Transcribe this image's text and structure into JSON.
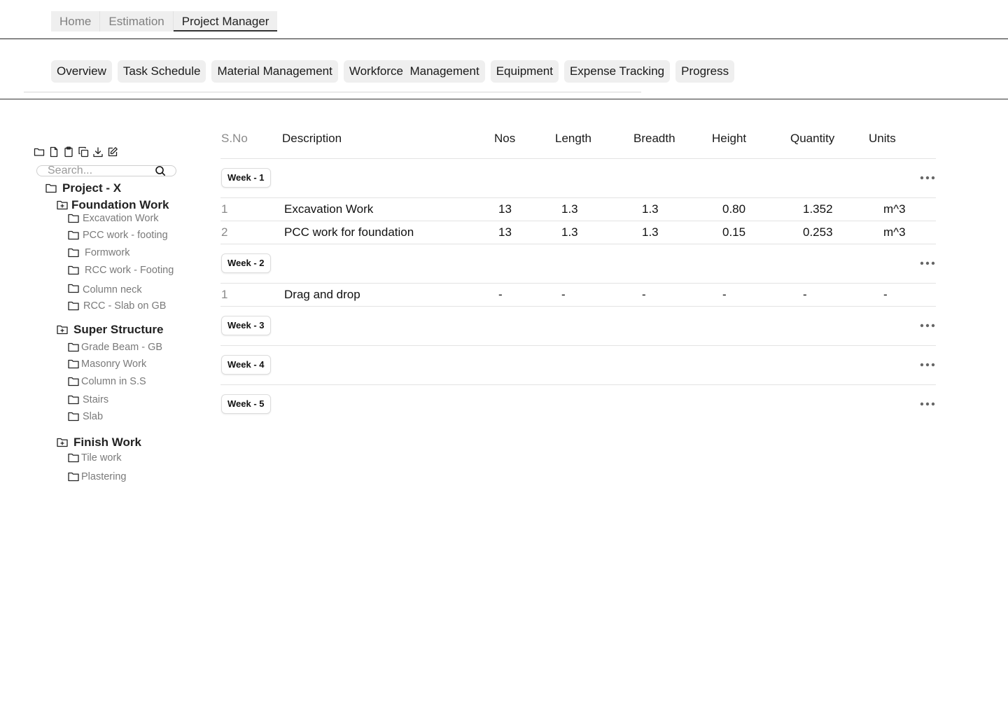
{
  "top_nav": {
    "tabs": [
      "Home",
      "Estimation",
      "Project Manager"
    ],
    "active": "Project Manager"
  },
  "sub_tabs": [
    "Overview",
    "Task Schedule",
    "Material Management",
    "Workforce  Management",
    "Equipment",
    "Expense Tracking",
    "Progress"
  ],
  "sidebar": {
    "toolbar_icons": [
      "folder-icon",
      "file-icon",
      "clipboard-icon",
      "copy-icon",
      "download-icon",
      "edit-icon"
    ],
    "search_placeholder": "Search...",
    "root": "Project - X",
    "groups": [
      {
        "label": "Foundation Work",
        "items": [
          "Excavation Work",
          "PCC work - footing",
          "Formwork",
          "RCC work - Footing",
          "Column neck",
          "RCC - Slab on GB"
        ]
      },
      {
        "label": "Super Structure",
        "items": [
          "Grade Beam - GB",
          "Masonry Work",
          "Column in S.S",
          "Stairs",
          "Slab"
        ]
      },
      {
        "label": "Finish Work",
        "items": [
          "Tile work",
          "Plastering"
        ]
      }
    ]
  },
  "table": {
    "headers": [
      "S.No",
      "Description",
      "Nos",
      "Length",
      "Breadth",
      "Height",
      "Quantity",
      "Units"
    ],
    "weeks": [
      {
        "label": "Week - 1",
        "rows": [
          {
            "sno": "1",
            "description": "Excavation Work",
            "nos": "13",
            "length": "1.3",
            "breadth": "1.3",
            "height": "0.80",
            "quantity": "1.352",
            "units": "m^3"
          },
          {
            "sno": "2",
            "description": "PCC work for foundation",
            "nos": "13",
            "length": "1.3",
            "breadth": "1.3",
            "height": "0.15",
            "quantity": "0.253",
            "units": "m^3"
          }
        ]
      },
      {
        "label": "Week - 2",
        "rows": [
          {
            "sno": "1",
            "description": "Drag and drop",
            "nos": "-",
            "length": "-",
            "breadth": "-",
            "height": "-",
            "quantity": "-",
            "units": "-"
          }
        ]
      },
      {
        "label": "Week - 3",
        "rows": []
      },
      {
        "label": "Week - 4",
        "rows": []
      },
      {
        "label": "Week - 5",
        "rows": []
      }
    ]
  }
}
